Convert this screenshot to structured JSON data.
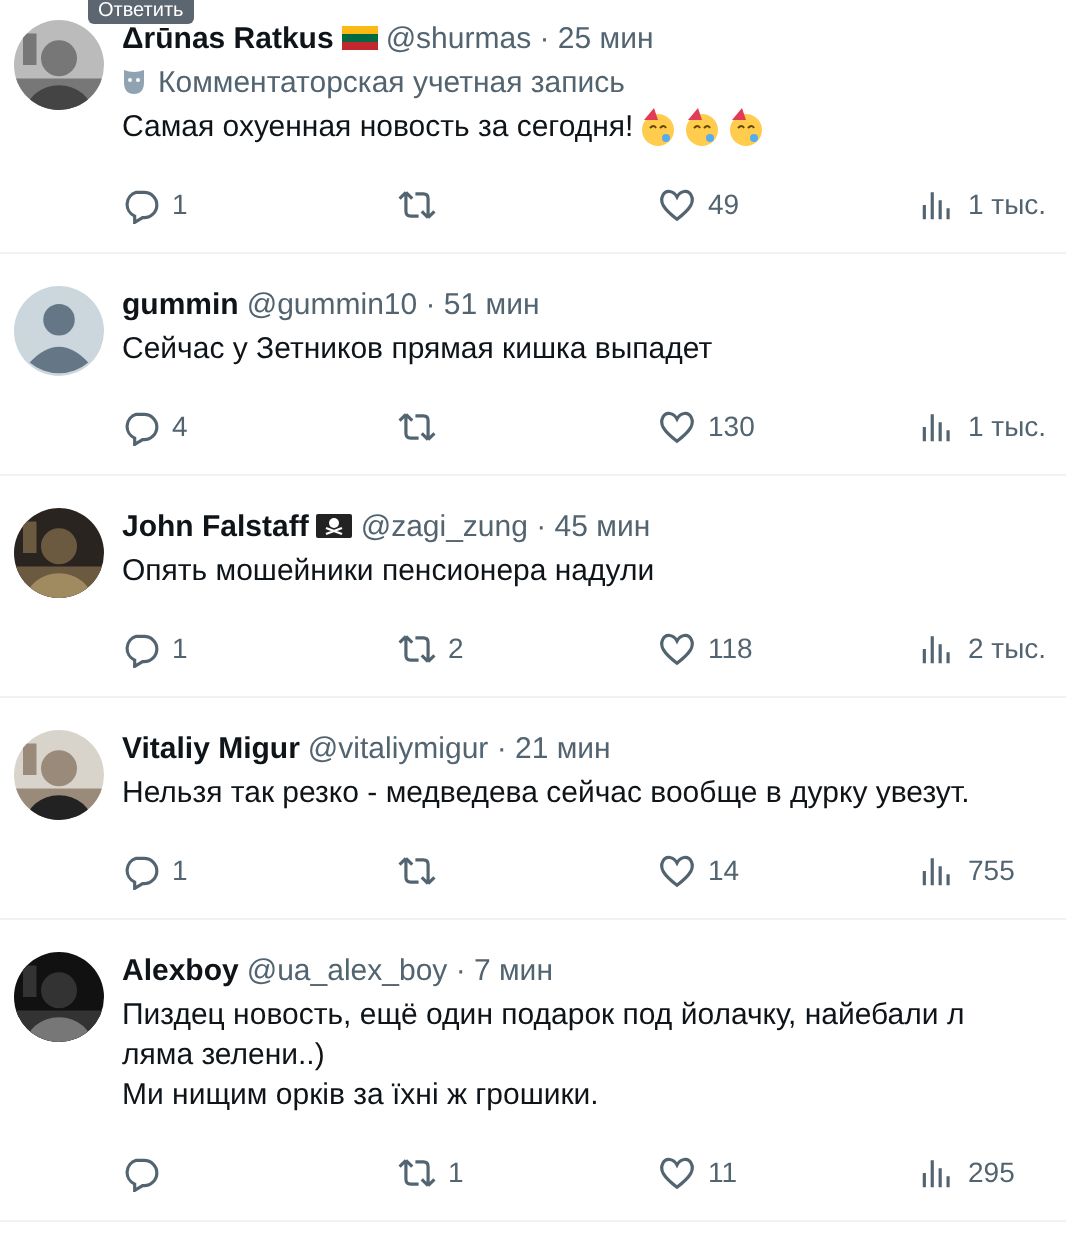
{
  "tooltip": {
    "label": "Ответить"
  },
  "replies": [
    {
      "name": "Δrūnas Ratkus",
      "name_badge": {
        "kind": "flag"
      },
      "handle": "@shurmas",
      "time": "· 25 мин",
      "account_label": "Комментаторская учетная запись",
      "lines": [
        "Самая охуенная новость за сегодня!"
      ],
      "emojis": [
        {
          "kind": "party"
        },
        {
          "kind": "party"
        },
        {
          "kind": "party"
        }
      ],
      "stats": {
        "replies": "1",
        "likes": "49",
        "views": "1 тыс."
      }
    },
    {
      "avatar": {
        "kind": "default"
      },
      "name": "gummin",
      "handle": "@gummin10",
      "time": "· 51 мин",
      "lines": [
        "Сейчас у Зетников прямая кишка выпадет"
      ],
      "stats": {
        "replies": "4",
        "likes": "130",
        "views": "1 тыс."
      }
    },
    {
      "name": "John Falstaff",
      "name_badge": {
        "kind": "pirate"
      },
      "handle": "@zagi_zung",
      "time": "· 45 мин",
      "lines": [
        "Опять мошейники пенсионера надули"
      ],
      "stats": {
        "replies": "1",
        "reposts": "2",
        "likes": "118",
        "views": "2 тыс."
      }
    },
    {
      "name": "Vitaliy Migur",
      "handle": "@vitaliymigur",
      "time": "· 21 мин",
      "lines": [
        "Нельзя так резко - медведева сейчас вообще в дурку увезут."
      ],
      "stats": {
        "replies": "1",
        "likes": "14",
        "views": "755"
      }
    },
    {
      "name": "Alexboy",
      "handle": "@ua_alex_boy",
      "time": "· 7 мин",
      "lines": [
        "Пиздец новость, ещё один подарок под йолачку, найебали л",
        "ляма зелени..)",
        "Ми нищим орків за їхні ж грошики."
      ],
      "stats": {
        "reposts": "1",
        "likes": "11",
        "views": "295"
      }
    }
  ]
}
